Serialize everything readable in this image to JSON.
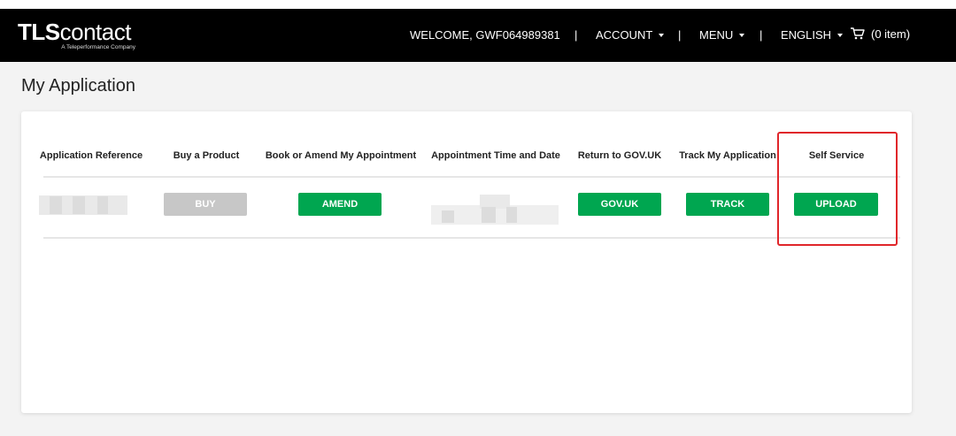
{
  "header": {
    "logo_main_bold": "TLS",
    "logo_main_rest": "contact",
    "logo_tagline": "A Teleperformance Company",
    "welcome": "WELCOME, GWF064989381",
    "account": "ACCOUNT",
    "menu": "MENU",
    "language": "ENGLISH",
    "cart": "(0 item)",
    "separator": "|"
  },
  "page": {
    "title": "My Application"
  },
  "table": {
    "headers": [
      "Application Reference",
      "Buy a Product",
      "Book or Amend My Appointment",
      "Appointment Time and Date",
      "Return to GOV.UK",
      "Track My Application",
      "Self Service"
    ],
    "buttons": {
      "buy": "BUY",
      "amend": "AMEND",
      "gov": "GOV.UK",
      "track": "TRACK",
      "upload": "UPLOAD"
    }
  },
  "colors": {
    "header_bg": "#000000",
    "button_green": "#00a650",
    "button_disabled": "#c7c7c7",
    "highlight_red": "#e0262a"
  },
  "icons": {
    "cart": "shopping-cart-icon",
    "dropdown": "caret-down-icon"
  }
}
